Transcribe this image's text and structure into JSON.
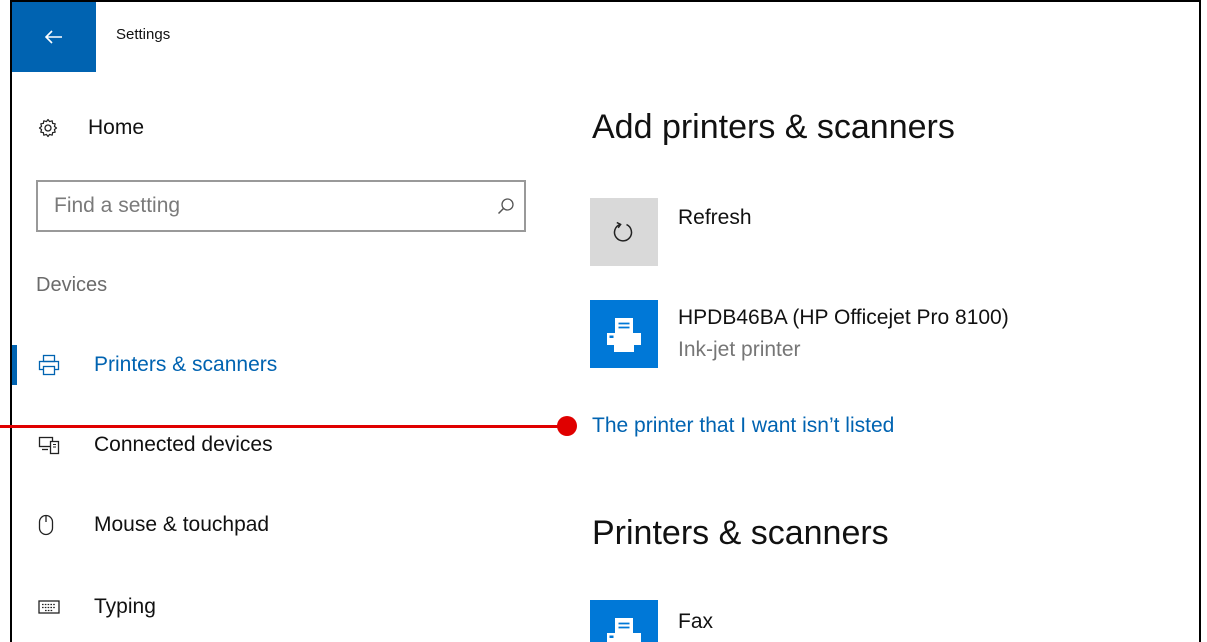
{
  "window": {
    "title": "Settings"
  },
  "sidebar": {
    "home_label": "Home",
    "search_placeholder": "Find a setting",
    "section_label": "Devices",
    "items": [
      {
        "label": "Printers & scanners",
        "icon": "printer-icon",
        "active": true
      },
      {
        "label": "Connected devices",
        "icon": "connected-devices-icon",
        "active": false
      },
      {
        "label": "Mouse & touchpad",
        "icon": "mouse-icon",
        "active": false
      },
      {
        "label": "Typing",
        "icon": "keyboard-icon",
        "active": false
      }
    ]
  },
  "main": {
    "add_heading": "Add printers & scanners",
    "refresh_label": "Refresh",
    "found_printer": {
      "name": "HPDB46BA (HP Officejet Pro 8100)",
      "type": "Ink-jet printer"
    },
    "not_listed_link": "The printer that I want isn’t listed",
    "list_heading": "Printers & scanners",
    "installed": [
      {
        "name": "Fax"
      }
    ]
  },
  "colors": {
    "accent": "#0063b1",
    "tile_blue": "#0078d7",
    "annotation": "#e00000"
  }
}
